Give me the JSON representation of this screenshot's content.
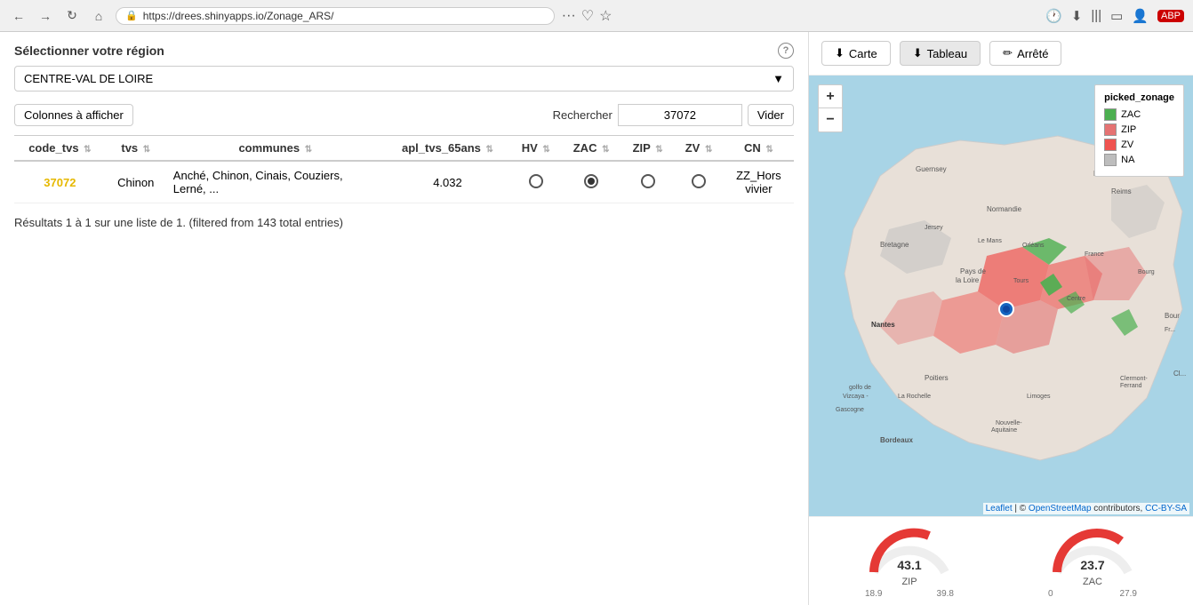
{
  "browser": {
    "url": "https://drees.shinyapps.io/Zonage_ARS/",
    "back_tooltip": "Back",
    "forward_tooltip": "Forward",
    "refresh_tooltip": "Refresh",
    "home_tooltip": "Home"
  },
  "app": {
    "region_selector": {
      "label": "Sélectionner votre région",
      "selected": "CENTRE-VAL DE LOIRE",
      "help": "?"
    },
    "toolbar": {
      "columns_btn": "Colonnes à afficher",
      "search_label": "Rechercher",
      "search_value": "37072",
      "vider_btn": "Vider"
    },
    "table": {
      "columns": [
        {
          "key": "code_tvs",
          "label": "code_tvs"
        },
        {
          "key": "tvs",
          "label": "tvs"
        },
        {
          "key": "communes",
          "label": "communes"
        },
        {
          "key": "apl_tvs_65ans",
          "label": "apl_tvs_65ans"
        },
        {
          "key": "HV",
          "label": "HV"
        },
        {
          "key": "ZAC",
          "label": "ZAC"
        },
        {
          "key": "ZIP",
          "label": "ZIP"
        },
        {
          "key": "ZV",
          "label": "ZV"
        },
        {
          "key": "CN",
          "label": "CN"
        }
      ],
      "rows": [
        {
          "code_tvs": "37072",
          "tvs": "Chinon",
          "communes": "Anché, Chinon, Cinais, Couziers, Lerné, ...",
          "apl_tvs_65ans": "4.032",
          "HV": "empty",
          "ZAC": "checked",
          "ZIP": "empty",
          "ZV": "empty",
          "CN": "ZZ_Hors vivier"
        }
      ],
      "results_text": "Résultats 1 à 1 sur une liste de 1. (filtered from 143 total entries)"
    },
    "map_buttons": [
      {
        "id": "carte",
        "label": "Carte",
        "icon": "download"
      },
      {
        "id": "tableau",
        "label": "Tableau",
        "icon": "download"
      },
      {
        "id": "arrete",
        "label": "Arrêté",
        "icon": "edit"
      }
    ],
    "legend": {
      "title": "picked_zonage",
      "items": [
        {
          "label": "ZAC",
          "color": "#4caf50"
        },
        {
          "label": "ZIP",
          "color": "#e57373"
        },
        {
          "label": "ZV",
          "color": "#ef5350"
        },
        {
          "label": "NA",
          "color": "#bdbdbd"
        }
      ]
    },
    "zoom_plus": "+",
    "zoom_minus": "−",
    "gauges": [
      {
        "id": "zip",
        "value": "43.1",
        "label": "ZIP",
        "min": "18.9",
        "max": "39.8"
      },
      {
        "id": "zac",
        "value": "23.7",
        "label": "ZAC",
        "min": "0",
        "max": "27.9"
      }
    ],
    "attribution": "Leaflet | © OpenStreetMap contributors, CC-BY-SA"
  }
}
